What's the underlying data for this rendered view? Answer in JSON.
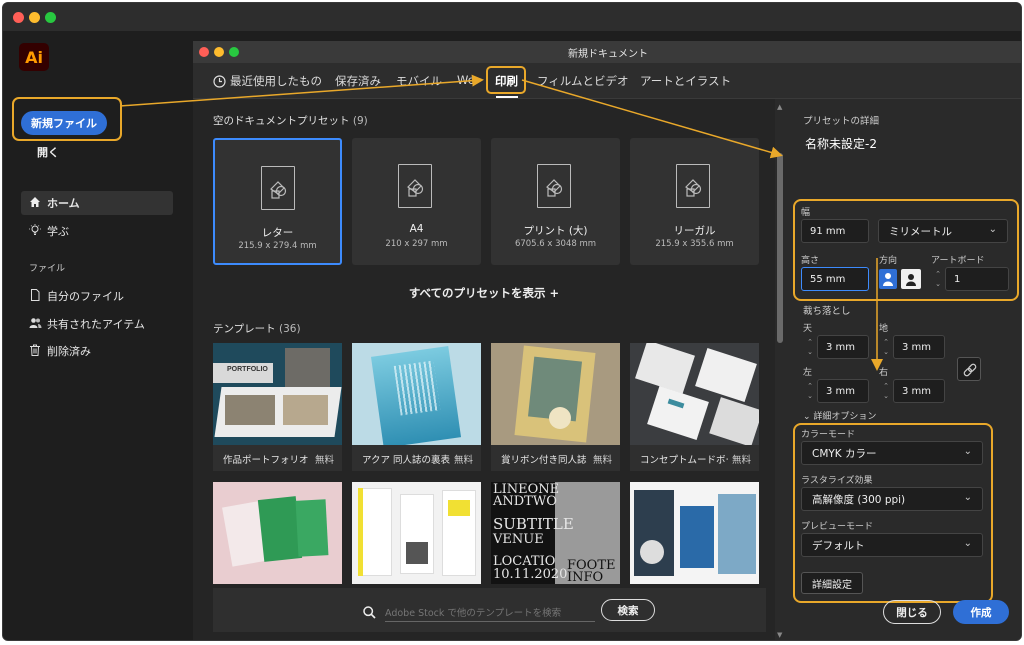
{
  "colors": {
    "accent": "#2f6fd6",
    "highlight": "#e9a82a",
    "selected_border": "#3d8bfd"
  },
  "app": {
    "logo": "Ai"
  },
  "sidebar": {
    "new_file": "新規ファイル",
    "open": "開く",
    "nav": [
      {
        "label": "ホーム",
        "icon": "home-icon"
      },
      {
        "label": "学ぶ",
        "icon": "lightbulb-icon"
      }
    ],
    "files_header": "ファイル",
    "files": [
      {
        "label": "自分のファイル",
        "icon": "file-icon"
      },
      {
        "label": "共有されたアイテム",
        "icon": "people-icon"
      },
      {
        "label": "削除済み",
        "icon": "trash-icon"
      }
    ]
  },
  "dialog": {
    "title": "新規ドキュメント",
    "tabs": [
      "最近使用したもの",
      "保存済み",
      "モバイル",
      "We",
      "印刷",
      "フィルムとビデオ",
      "アートとイラスト"
    ],
    "active_tab": "印刷",
    "blank_presets_header": "空のドキュメントプリセット",
    "blank_presets_count": "(9)",
    "presets": [
      {
        "name": "レター",
        "size": "215.9 x 279.4 mm"
      },
      {
        "name": "A4",
        "size": "210 x 297 mm"
      },
      {
        "name": "プリント (大)",
        "size": "6705.6 x 3048 mm"
      },
      {
        "name": "リーガル",
        "size": "215.9 x 355.6 mm"
      }
    ],
    "show_all": "すべてのプリセットを表示 +",
    "templates_header": "テンプレート",
    "templates_count": "(36)",
    "templates": [
      {
        "caption": "作品ポートフォリオ",
        "price": "無料"
      },
      {
        "caption": "アクア 同人誌の裏表紙",
        "price": "無料"
      },
      {
        "caption": "賞リボン付き同人誌",
        "price": "無料"
      },
      {
        "caption": "コンセプトムードボード",
        "price": "無料"
      }
    ],
    "template_text": {
      "portfolio": "PORTFOLIO",
      "lines": [
        "LINEONE",
        "ANDTWO",
        "SUBTITLE",
        "VENUE",
        "LOCATIO",
        "10.11.2020",
        "FOOTE",
        "INFO"
      ]
    },
    "search": {
      "placeholder": "Adobe Stock で他のテンプレートを検索",
      "button": "検索"
    }
  },
  "details": {
    "header": "プリセットの詳細",
    "name": "名称未設定-2",
    "width_label": "幅",
    "width": "91 mm",
    "unit": "ミリメートル",
    "height_label": "高さ",
    "height": "55 mm",
    "orientation_label": "方向",
    "artboard_label": "アートボード",
    "artboards": "1",
    "bleed_label": "裁ち落とし",
    "bleed": {
      "top_label": "天",
      "top": "3 mm",
      "bottom_label": "地",
      "bottom": "3 mm",
      "left_label": "左",
      "left": "3 mm",
      "right_label": "右",
      "right": "3 mm"
    },
    "advanced_label": "詳細オプション",
    "color_mode_label": "カラーモード",
    "color_mode": "CMYK カラー",
    "raster_label": "ラスタライズ効果",
    "raster": "高解像度 (300 ppi)",
    "preview_label": "プレビューモード",
    "preview": "デフォルト",
    "more_settings": "詳細設定",
    "close": "閉じる",
    "create": "作成"
  }
}
